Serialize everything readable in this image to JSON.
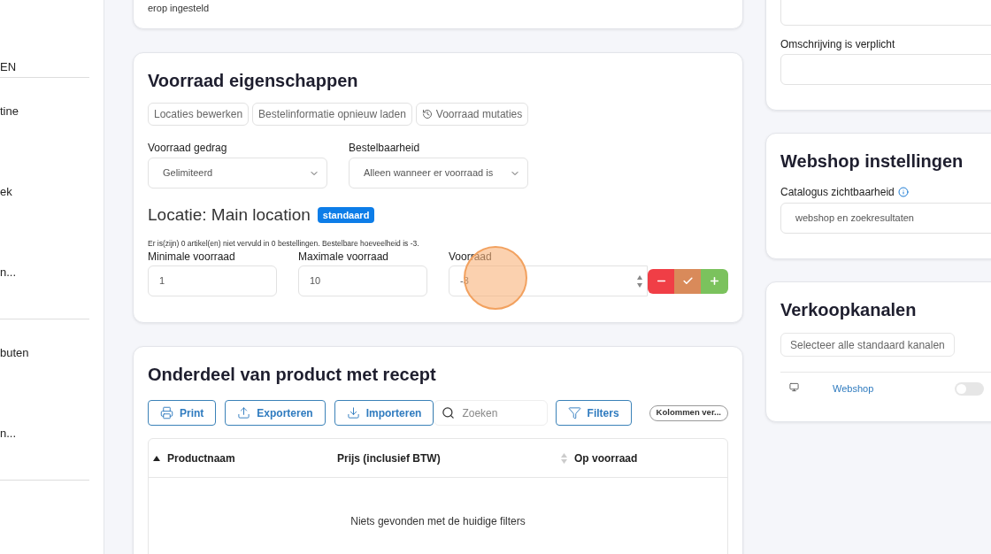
{
  "sidebar": {
    "items": [
      {
        "label": "EN",
        "kind": "header"
      },
      {
        "label": "tine",
        "kind": "item",
        "divider_after": false
      },
      {
        "label": "ek",
        "kind": "item",
        "divider_after": false
      },
      {
        "label": "n...",
        "kind": "item",
        "divider_after": true
      },
      {
        "label": "buten",
        "kind": "item",
        "divider_after": false
      },
      {
        "label": "n...",
        "kind": "item",
        "divider_after": true
      }
    ]
  },
  "top_card": {
    "text": "erop ingesteld"
  },
  "stock_card": {
    "title": "Voorraad eigenschappen",
    "actions": [
      {
        "label": "Locaties bewerken",
        "icon": false
      },
      {
        "label": "Bestelinformatie opnieuw laden",
        "icon": false
      },
      {
        "label": "Voorraad mutaties",
        "icon": true
      }
    ],
    "selects": [
      {
        "label": "Voorraad gedrag",
        "value": "Gelimiteerd"
      },
      {
        "label": "Bestelbaarheid",
        "value": "Alleen wanneer er voorraad is"
      }
    ],
    "location": {
      "title": "Locatie: Main location",
      "badge": "standaard"
    },
    "info": "Er is(zijn) 0 artikel(en) niet vervuld in 0 bestellingen. Bestelbare hoeveelheid is -3.",
    "fields": [
      {
        "label": "Minimale voorraad",
        "value": "1",
        "kind": "text"
      },
      {
        "label": "Maximale voorraad",
        "value": "10",
        "kind": "text"
      },
      {
        "label": "Voorraad",
        "value": "-3",
        "kind": "stepper"
      }
    ]
  },
  "recipe_card": {
    "title": "Onderdeel van product met recept",
    "toolbar": [
      {
        "label": "Print"
      },
      {
        "label": "Exporteren"
      },
      {
        "label": "Importeren"
      }
    ],
    "search": {
      "placeholder": "Zoeken"
    },
    "filters": "Filters",
    "columns_button": "Kolommen ver...",
    "table": {
      "columns": [
        {
          "label": "Productnaam"
        },
        {
          "label": "Prijs (inclusief BTW)"
        },
        {
          "label": "Op voorraad"
        }
      ],
      "empty": "Niets gevonden met de huidige filters"
    }
  },
  "description_card": {
    "label": "Omschrijving is verplicht"
  },
  "webshop_card": {
    "title": "Webshop instellingen",
    "label": "Catalogus zichtbaarheid",
    "value": "webshop en zoekresultaten"
  },
  "channels_card": {
    "title": "Verkoopkanalen",
    "select_all": "Selecteer alle standaard kanalen",
    "channels": [
      {
        "name": "Webshop",
        "on": false
      }
    ]
  }
}
